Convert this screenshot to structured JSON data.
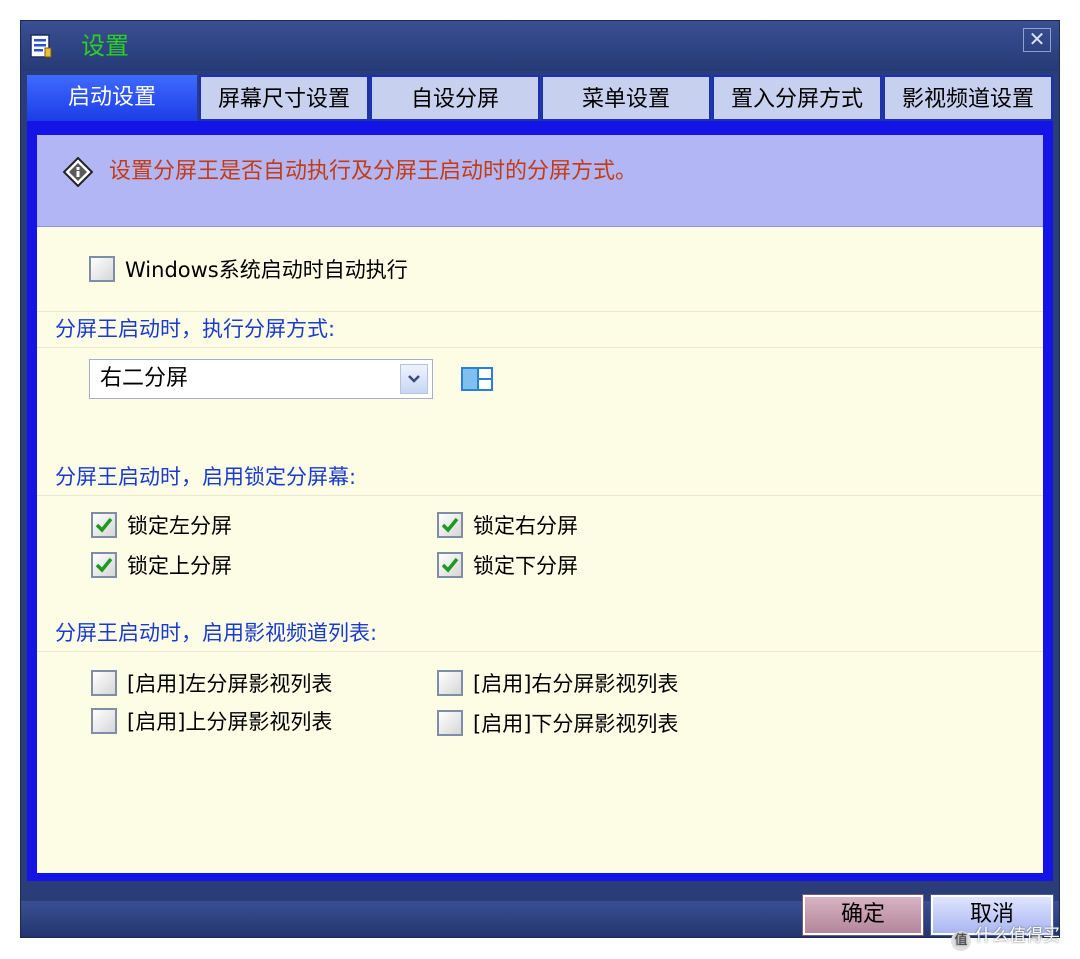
{
  "window": {
    "title": "设置",
    "close_glyph": "✕"
  },
  "tabs": [
    {
      "label": "启动设置",
      "active": true
    },
    {
      "label": "屏幕尺寸设置",
      "active": false
    },
    {
      "label": "自设分屏",
      "active": false
    },
    {
      "label": "菜单设置",
      "active": false
    },
    {
      "label": "置入分屏方式",
      "active": false
    },
    {
      "label": "影视频道设置",
      "active": false
    }
  ],
  "banner": {
    "text": "设置分屏王是否自动执行及分屏王启动时的分屏方式。",
    "icon": "info-diamond-icon"
  },
  "autostart": {
    "label": "Windows系统启动时自动执行",
    "checked": false
  },
  "split_mode": {
    "section_label": "分屏王启动时，执行分屏方式:",
    "selected": "右二分屏"
  },
  "lock": {
    "section_label": "分屏王启动时，启用锁定分屏幕:",
    "items": [
      {
        "label": "锁定左分屏",
        "checked": true
      },
      {
        "label": "锁定右分屏",
        "checked": true
      },
      {
        "label": "锁定上分屏",
        "checked": true
      },
      {
        "label": "锁定下分屏",
        "checked": true
      }
    ]
  },
  "video": {
    "section_label": "分屏王启动时，启用影视频道列表:",
    "items": [
      {
        "label": "[启用]左分屏影视列表",
        "checked": false
      },
      {
        "label": "[启用]右分屏影视列表",
        "checked": false
      },
      {
        "label": "[启用]上分屏影视列表",
        "checked": false
      },
      {
        "label": "[启用]下分屏影视列表",
        "checked": false
      }
    ]
  },
  "buttons": {
    "ok": "确定",
    "cancel": "取消"
  },
  "watermark": {
    "text": "什么值得买",
    "logo": "值"
  },
  "colors": {
    "title_green": "#2bd11e",
    "banner_text": "#c43b12",
    "section_blue": "#1a3bd0",
    "frame_blue": "#1414e6",
    "check_green": "#1f9a1f"
  }
}
